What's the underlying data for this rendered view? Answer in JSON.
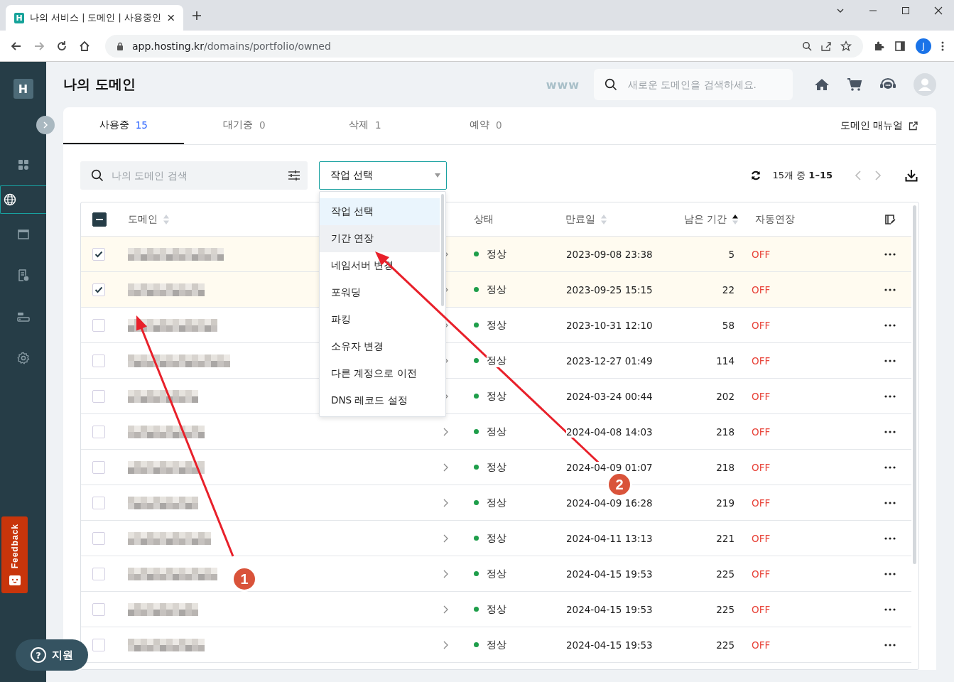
{
  "browser": {
    "tab_title": "나의 서비스 | 도메인 | 사용중인",
    "favicon": "H",
    "url_host": "app.hosting.kr",
    "url_path": "/domains/portfolio/owned",
    "profile": "J"
  },
  "sidebar": {
    "logo": "H",
    "items": [
      {
        "kind": "grid",
        "selected": false
      },
      {
        "kind": "globe",
        "selected": true
      },
      {
        "kind": "window",
        "selected": false
      },
      {
        "kind": "invoice",
        "selected": false
      },
      {
        "kind": "server",
        "selected": false
      },
      {
        "kind": "gear",
        "selected": false
      }
    ],
    "feedback": "Feedback",
    "support": {
      "icon": "?",
      "label": "지원"
    }
  },
  "header": {
    "title": "나의 도메인",
    "prefix": "www",
    "search_placeholder": "새로운 도메인을 검색하세요."
  },
  "tabs": [
    {
      "label": "사용중",
      "count": "15",
      "selected": true
    },
    {
      "label": "대기중",
      "count": "0",
      "selected": false
    },
    {
      "label": "삭제",
      "count": "1",
      "selected": false
    },
    {
      "label": "예약",
      "count": "0",
      "selected": false
    }
  ],
  "manual_link": "도메인 매뉴얼",
  "filter": {
    "placeholder": "나의 도메인 검색"
  },
  "action_select": {
    "value": "작업 선택",
    "options": [
      {
        "label": "작업 선택",
        "selected": true,
        "hovered": false
      },
      {
        "label": "기간 연장",
        "selected": false,
        "hovered": true
      },
      {
        "label": "네임서버 변경",
        "selected": false,
        "hovered": false
      },
      {
        "label": "포워딩",
        "selected": false,
        "hovered": false
      },
      {
        "label": "파킹",
        "selected": false,
        "hovered": false
      },
      {
        "label": "소유자 변경",
        "selected": false,
        "hovered": false
      },
      {
        "label": "다른 계정으로 이전",
        "selected": false,
        "hovered": false
      },
      {
        "label": "DNS 레코드 설정",
        "selected": false,
        "hovered": false
      }
    ]
  },
  "pagination": "15개 중 **1–15**",
  "table": {
    "select_all": {
      "indeterminate": true
    },
    "columns": [
      {
        "label": "도메인",
        "sorted_ascending": false
      },
      {
        "label": "상태"
      },
      {
        "label": "만료일",
        "sorted_ascending": false
      },
      {
        "label": "남은 기간",
        "sorted_ascending": true
      },
      {
        "label": "자동연장"
      }
    ],
    "rows": [
      {
        "checked": true,
        "status": "정상",
        "expires": "2023-09-08 23:38",
        "remaining": "5",
        "auto_renew": "OFF"
      },
      {
        "checked": true,
        "status": "정상",
        "expires": "2023-09-25 15:15",
        "remaining": "22",
        "auto_renew": "OFF"
      },
      {
        "checked": false,
        "status": "정상",
        "expires": "2023-10-31 12:10",
        "remaining": "58",
        "auto_renew": "OFF"
      },
      {
        "checked": false,
        "status": "정상",
        "expires": "2023-12-27 01:49",
        "remaining": "114",
        "auto_renew": "OFF"
      },
      {
        "checked": false,
        "status": "정상",
        "expires": "2024-03-24 00:44",
        "remaining": "202",
        "auto_renew": "OFF"
      },
      {
        "checked": false,
        "status": "정상",
        "expires": "2024-04-08 14:03",
        "remaining": "218",
        "auto_renew": "OFF"
      },
      {
        "checked": false,
        "status": "정상",
        "expires": "2024-04-09 01:07",
        "remaining": "218",
        "auto_renew": "OFF"
      },
      {
        "checked": false,
        "status": "정상",
        "expires": "2024-04-09 16:28",
        "remaining": "219",
        "auto_renew": "OFF"
      },
      {
        "checked": false,
        "status": "정상",
        "expires": "2024-04-11 13:13",
        "remaining": "221",
        "auto_renew": "OFF"
      },
      {
        "checked": false,
        "status": "정상",
        "expires": "2024-04-15 19:53",
        "remaining": "225",
        "auto_renew": "OFF"
      },
      {
        "checked": false,
        "status": "정상",
        "expires": "2024-04-15 19:53",
        "remaining": "225",
        "auto_renew": "OFF"
      },
      {
        "checked": false,
        "status": "정상",
        "expires": "2024-04-15 19:53",
        "remaining": "225",
        "auto_renew": "OFF"
      }
    ]
  },
  "annotations": [
    {
      "label": "1"
    },
    {
      "label": "2"
    }
  ]
}
